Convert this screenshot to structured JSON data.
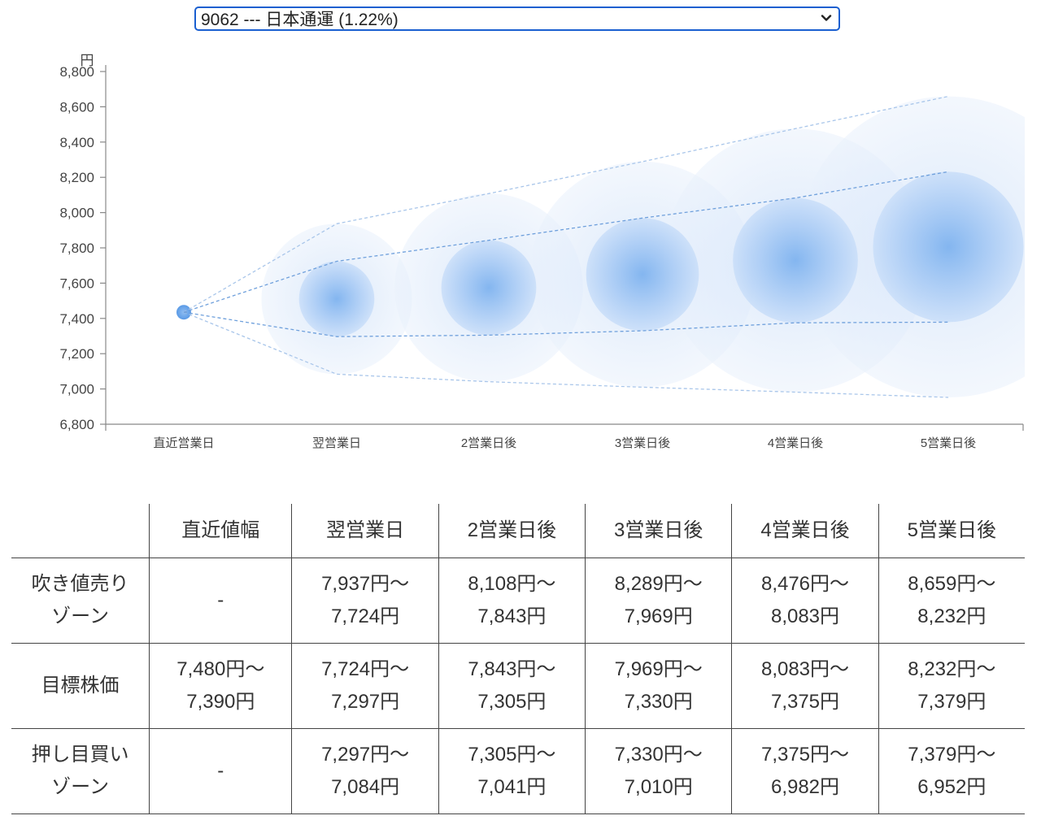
{
  "select": {
    "value": "9062 --- 日本通運 (1.22%)"
  },
  "chart_data": {
    "type": "scatter",
    "unit_label": "円",
    "ylim": [
      6800,
      8800
    ],
    "yticks": [
      "6,800",
      "7,000",
      "7,200",
      "7,400",
      "7,600",
      "7,800",
      "8,000",
      "8,200",
      "8,400",
      "8,600",
      "8,800"
    ],
    "ytick_values": [
      6800,
      7000,
      7200,
      7400,
      7600,
      7800,
      8000,
      8200,
      8400,
      8600,
      8800
    ],
    "categories": [
      "直近営業日",
      "翌営業日",
      "2営業日後",
      "3営業日後",
      "4営業日後",
      "5営業日後"
    ],
    "center": [
      7435,
      7510,
      7574,
      7650,
      7729,
      7806
    ],
    "target_high": [
      7435,
      7724,
      7843,
      7969,
      8083,
      8232
    ],
    "target_low": [
      7435,
      7297,
      7305,
      7330,
      7375,
      7379
    ],
    "zone_high": [
      7435,
      7937,
      8108,
      8289,
      8476,
      8659
    ],
    "zone_low": [
      7435,
      7084,
      7041,
      7010,
      6982,
      6952
    ],
    "grid": false,
    "legend": "none"
  },
  "table": {
    "headers": [
      "",
      "直近値幅",
      "翌営業日",
      "2営業日後",
      "3営業日後",
      "4営業日後",
      "5営業日後"
    ],
    "rows": [
      {
        "label": [
          "吹き値売り",
          "ゾーン"
        ],
        "cells": [
          [
            "-"
          ],
          [
            "7,937円〜",
            "7,724円"
          ],
          [
            "8,108円〜",
            "7,843円"
          ],
          [
            "8,289円〜",
            "7,969円"
          ],
          [
            "8,476円〜",
            "8,083円"
          ],
          [
            "8,659円〜",
            "8,232円"
          ]
        ]
      },
      {
        "label": [
          "目標株価"
        ],
        "cells": [
          [
            "7,480円〜",
            "7,390円"
          ],
          [
            "7,724円〜",
            "7,297円"
          ],
          [
            "7,843円〜",
            "7,305円"
          ],
          [
            "7,969円〜",
            "7,330円"
          ],
          [
            "8,083円〜",
            "7,375円"
          ],
          [
            "8,232円〜",
            "7,379円"
          ]
        ]
      },
      {
        "label": [
          "押し目買い",
          "ゾーン"
        ],
        "cells": [
          [
            "-"
          ],
          [
            "7,297円〜",
            "7,084円"
          ],
          [
            "7,305円〜",
            "7,041円"
          ],
          [
            "7,330円〜",
            "7,010円"
          ],
          [
            "7,375円〜",
            "6,982円"
          ],
          [
            "7,379円〜",
            "6,952円"
          ]
        ]
      }
    ]
  },
  "colors": {
    "select_border": "#1a5fd0",
    "bubble": "#4a90e2",
    "bubble_light": "#d6e6fa",
    "axis": "#888888",
    "table_border": "#444444"
  }
}
